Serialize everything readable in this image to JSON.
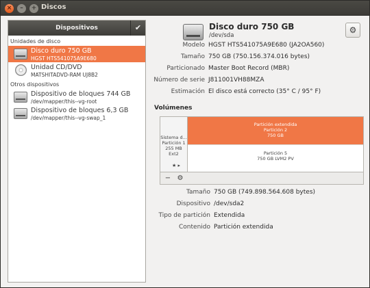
{
  "window": {
    "title": "Discos"
  },
  "sidebar": {
    "header": "Dispositivos",
    "check_glyph": "✔",
    "section_disks": "Unidades de disco",
    "section_other": "Otros dispositivos",
    "items": [
      {
        "name": "Disco duro 750 GB",
        "sub": "HGST HTS541075A9E680",
        "icon": "hard-disk-icon"
      },
      {
        "name": "Unidad CD/DVD",
        "sub": "MATSHITADVD-RAM UJ8B2",
        "icon": "optical-drive-icon"
      },
      {
        "name": "Dispositivo de bloques 744 GB",
        "sub": "/dev/mapper/this--vg-root",
        "icon": "hard-disk-icon"
      },
      {
        "name": "Dispositivo de bloques 6,3 GB",
        "sub": "/dev/mapper/this--vg-swap_1",
        "icon": "hard-disk-icon"
      }
    ]
  },
  "drive": {
    "title": "Disco duro 750 GB",
    "device": "/dev/sda",
    "gear_glyph": "⚙",
    "props": [
      {
        "k": "Modelo",
        "v": "HGST HTS541075A9E680 (JA2OA560)"
      },
      {
        "k": "Tamaño",
        "v": "750 GB (750.156.374.016 bytes)"
      },
      {
        "k": "Particionado",
        "v": "Master Boot Record (MBR)"
      },
      {
        "k": "Número de serie",
        "v": "J811001VH88MZA"
      },
      {
        "k": "Estimación",
        "v": "El disco está correcto (35° C / 95° F)"
      }
    ]
  },
  "volumes": {
    "title": "Volúmenes",
    "p1": {
      "line1": "Sistema d...",
      "line2": "Partición 1",
      "line3": "255 MB Ext2",
      "stars": "★ ▸"
    },
    "ext": {
      "line1": "Partición extendida",
      "line2": "Partición 2",
      "line3": "750 GB"
    },
    "p5": {
      "line1": "Partición 5",
      "line2": "750 GB LVM2 PV"
    },
    "toolbar": {
      "minus": "−",
      "settings": "⚙"
    }
  },
  "selected_volume": {
    "props": [
      {
        "k": "Tamaño",
        "v": "750 GB (749.898.564.608 bytes)"
      },
      {
        "k": "Dispositivo",
        "v": "/dev/sda2"
      },
      {
        "k": "Tipo de partición",
        "v": "Extendida"
      },
      {
        "k": "Contenido",
        "v": "Partición extendida"
      }
    ]
  },
  "colors": {
    "accent": "#f07746",
    "titlebar": "#3c3b37"
  }
}
